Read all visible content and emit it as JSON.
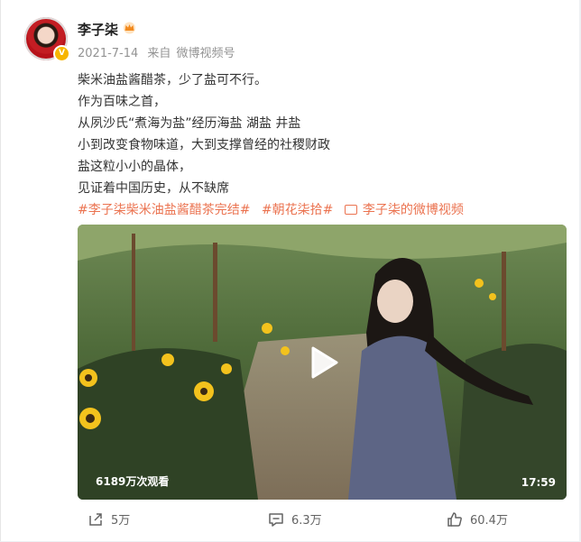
{
  "post": {
    "author": "李子柒",
    "date": "2021-7-14",
    "source_prefix": "来自",
    "source": "微博视频号",
    "lines": [
      "柴米油盐酱醋茶，少了盐可不行。",
      "作为百味之首，",
      "从夙沙氏“煮海为盐”经历海盐 湖盐 井盐",
      "小到改变食物味道，大到支撑曾经的社稷财政",
      "盐这粒小小的晶体，",
      "见证着中国历史，从不缺席"
    ],
    "tags": [
      "#李子柒柴米油盐酱醋茶完结#",
      "#朝花柒拾#"
    ],
    "video_link": "李子柒的微博视频",
    "verified_badge": "V"
  },
  "video": {
    "views": "6189万次观看",
    "duration": "17:59"
  },
  "actions": {
    "share_count": "5万",
    "comment_count": "6.3万",
    "like_count": "60.4万"
  },
  "colors": {
    "tag": "#eb7350",
    "text": "#333333",
    "meta": "#939393"
  }
}
